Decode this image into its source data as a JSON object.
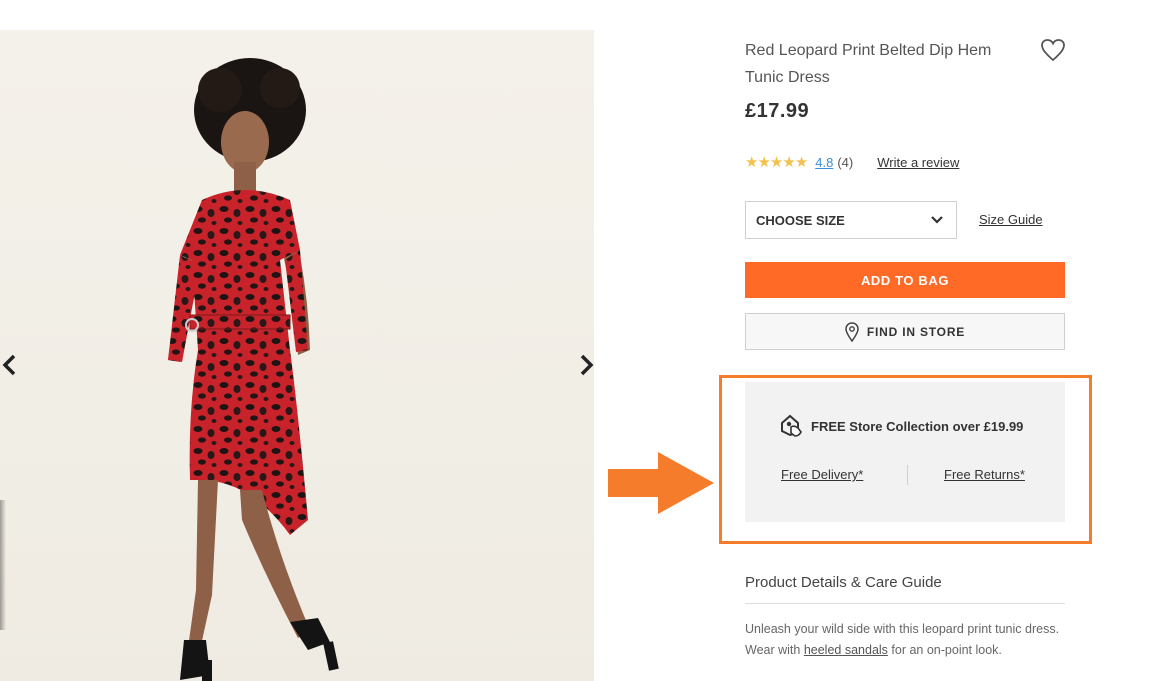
{
  "product": {
    "title": "Red Leopard Print Belted Dip Hem Tunic Dress",
    "price": "£17.99",
    "rating": {
      "stars": 5,
      "value": "4.8",
      "count": "(4)",
      "write_review": "Write a review"
    },
    "size_select": {
      "label": "CHOOSE SIZE",
      "icon": "chevron-down-icon"
    },
    "size_guide": "Size Guide",
    "add_to_bag": "ADD TO BAG",
    "find_in_store": "FIND IN STORE",
    "wishlist_icon": "heart-outline-icon"
  },
  "delivery": {
    "headline": "FREE Store Collection over £19.99",
    "free_delivery": "Free Delivery*",
    "free_returns": "Free Returns*",
    "icon": "store-collection-icon"
  },
  "details": {
    "heading": "Product Details & Care Guide",
    "description_part1": "Unleash your wild side with this leopard print tunic dress. Wear with ",
    "description_link": "heeled sandals",
    "description_part2": " for an on-point look."
  },
  "gallery": {
    "prev_icon": "chevron-left-icon",
    "next_icon": "chevron-right-icon"
  },
  "colors": {
    "accent": "#ff6a26",
    "highlight": "#f47c2a",
    "star": "#f2c14e",
    "link": "#3a8fd8"
  }
}
